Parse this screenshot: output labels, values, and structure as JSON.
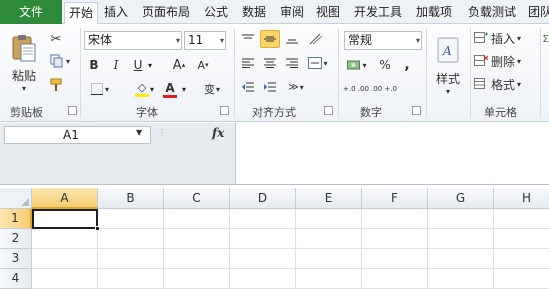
{
  "tabs": {
    "file": "文件",
    "items": [
      {
        "label": "开始",
        "active": true
      },
      {
        "label": "插入"
      },
      {
        "label": "页面布局"
      },
      {
        "label": "公式"
      },
      {
        "label": "数据"
      },
      {
        "label": "审阅"
      },
      {
        "label": "视图"
      },
      {
        "label": "开发工具"
      },
      {
        "label": "加载项"
      },
      {
        "label": "负载测试"
      },
      {
        "label": "团队"
      }
    ]
  },
  "clipboard": {
    "paste_label": "粘贴",
    "group_label": "剪贴板"
  },
  "font": {
    "name": "宋体",
    "size": "11",
    "bold": "B",
    "italic": "I",
    "underline": "U",
    "grow": "A",
    "shrink": "A",
    "font_color_letter": "A",
    "group_label": "字体",
    "wen_char": "变"
  },
  "alignment": {
    "group_label": "对齐方式"
  },
  "number": {
    "format": "常规",
    "percent": "%",
    "comma": ",",
    "group_label": "数字",
    "inc_decimal": "+.0 .00",
    "dec_decimal": ".00 +.0"
  },
  "styles": {
    "label": "样式"
  },
  "cells": {
    "insert": "插入",
    "delete": "删除",
    "format": "格式",
    "group_label": "单元格"
  },
  "formula_bar": {
    "name_box": "A1",
    "fx": "fx",
    "value": ""
  },
  "sheet": {
    "columns": [
      "A",
      "B",
      "C",
      "D",
      "E",
      "F",
      "G",
      "H"
    ],
    "rows": [
      "1",
      "2",
      "3",
      "4"
    ],
    "selected_column": "A",
    "selected_row": "1",
    "active_cell": "A1"
  },
  "colors": {
    "file_tab": "#2d8a3a",
    "selection": "#f7cd71",
    "highlight_fill": "#ffe800",
    "font_color": "#e02020"
  }
}
